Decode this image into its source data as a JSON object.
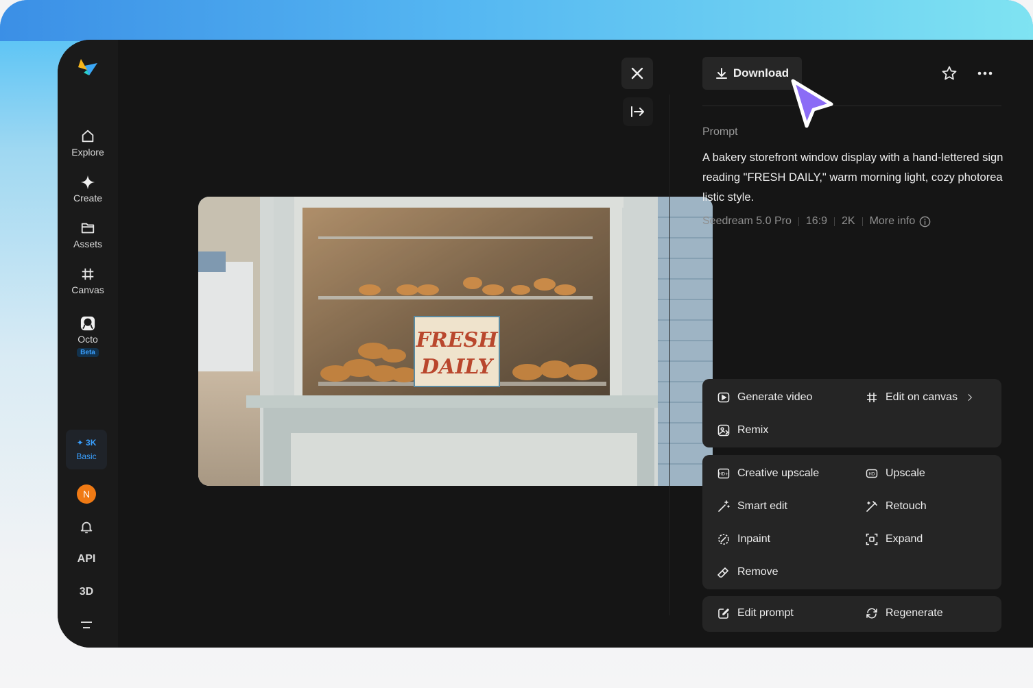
{
  "sidebar": {
    "nav": [
      {
        "label": "Explore",
        "icon": "home-icon"
      },
      {
        "label": "Create",
        "icon": "sparkle-icon"
      },
      {
        "label": "Assets",
        "icon": "folder-icon"
      },
      {
        "label": "Canvas",
        "icon": "canvas-icon"
      },
      {
        "label": "Octo",
        "icon": "octo-icon",
        "badge": "Beta"
      }
    ],
    "credits": {
      "amount": "✦ 3K",
      "plan": "Basic"
    },
    "avatar_initial": "N",
    "api_label": "API",
    "threed_label": "3D"
  },
  "right": {
    "download_label": "Download",
    "prompt_label": "Prompt",
    "prompt_text": "A bakery storefront window display with a hand-lettered sign reading \"FRESH DAILY,\" warm morning light, cozy photorealistic style.",
    "meta": {
      "model": "Seedream 5.0 Pro",
      "ratio": "16:9",
      "resolution": "2K",
      "more_info": "More info"
    },
    "actions_primary": {
      "generate_video": "Generate video",
      "edit_on_canvas": "Edit on canvas",
      "remix": "Remix"
    },
    "actions_edit": {
      "creative_upscale": "Creative upscale",
      "upscale": "Upscale",
      "smart_edit": "Smart edit",
      "retouch": "Retouch",
      "inpaint": "Inpaint",
      "expand": "Expand",
      "remove": "Remove"
    },
    "actions_bottom": {
      "edit_prompt": "Edit prompt",
      "regenerate": "Regenerate"
    }
  },
  "image": {
    "sign_line1": "FRESH",
    "sign_line2": "DAILY"
  },
  "colors": {
    "accent": "#3aa0ff",
    "avatar": "#f07a14",
    "cursor": "#8b6cf6"
  }
}
